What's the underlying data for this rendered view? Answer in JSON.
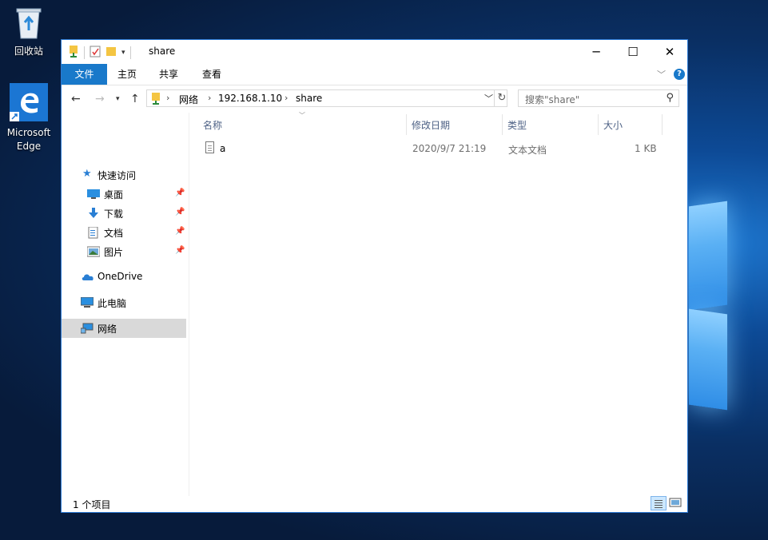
{
  "desktop": {
    "icons": [
      {
        "label": "回收站",
        "icon": "recycle-bin-icon"
      },
      {
        "label": "Microsoft Edge",
        "icon": "edge-icon"
      }
    ]
  },
  "window": {
    "title": "share",
    "controls": {
      "minimize": "─",
      "maximize": "☐",
      "close": "✕"
    }
  },
  "ribbon": {
    "tabs": [
      "文件",
      "主页",
      "共享",
      "查看"
    ]
  },
  "address": {
    "crumbs": [
      "网络",
      "192.168.1.10",
      "share"
    ]
  },
  "search": {
    "placeholder": "搜索\"share\""
  },
  "nav": {
    "quick_access": "快速访问",
    "pinned": [
      {
        "label": "桌面",
        "icon": "desktop-icon"
      },
      {
        "label": "下载",
        "icon": "download-icon"
      },
      {
        "label": "文档",
        "icon": "documents-icon"
      },
      {
        "label": "图片",
        "icon": "pictures-icon"
      }
    ],
    "onedrive": "OneDrive",
    "this_pc": "此电脑",
    "network": "网络"
  },
  "columns": {
    "name": "名称",
    "modified": "修改日期",
    "type": "类型",
    "size": "大小"
  },
  "files": [
    {
      "name": "a",
      "modified": "2020/9/7 21:19",
      "type": "文本文档",
      "size": "1 KB"
    }
  ],
  "status": {
    "count": "1 个项目"
  },
  "colors": {
    "accent": "#1979ca",
    "selection": "#d9d9d9",
    "window_border": "#2b79d4"
  }
}
